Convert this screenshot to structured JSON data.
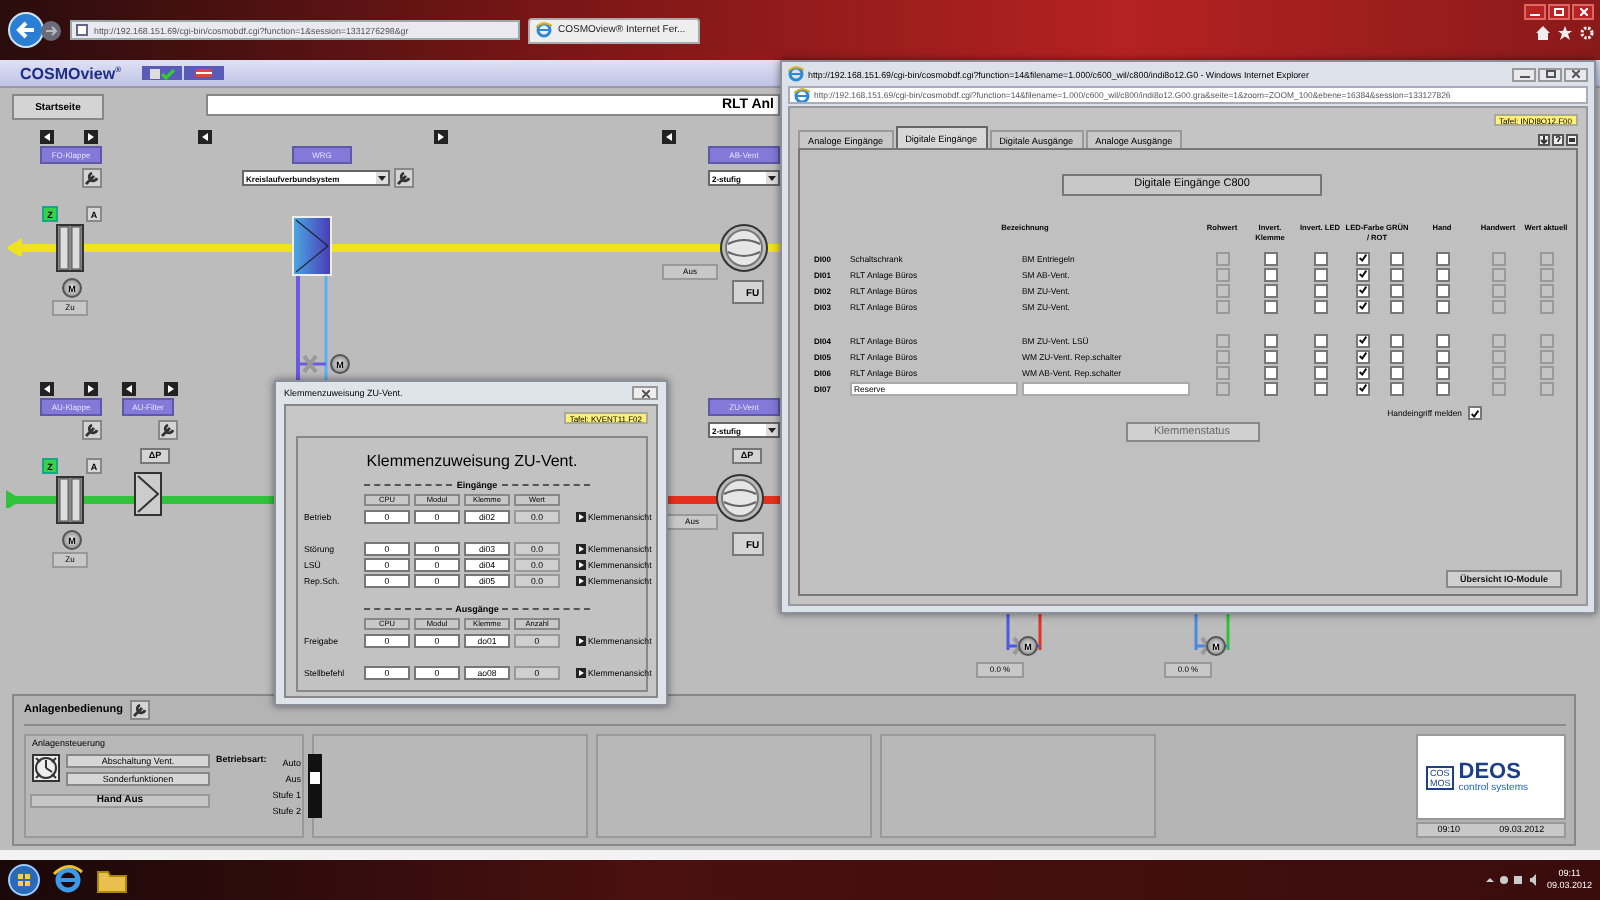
{
  "browser": {
    "address": "http://192.168.151.69/cgi-bin/cosmobdf.cgi?function=1&session=1331276298&gr",
    "tab": "COSMOview® Internet Fer..."
  },
  "app": {
    "logo": "COSMOview$^{®}$",
    "home_button": "Startseite",
    "page_title": "RLT Anl"
  },
  "schematic": {
    "exhaust": {
      "damper": {
        "label": "FO-Klappe",
        "buttons": [
          {
            "label": "Z",
            "selected": true
          },
          {
            "label": "A",
            "selected": false
          }
        ],
        "motor": "M",
        "value": "Zu"
      },
      "recovery": {
        "label": "WRG",
        "dropdown": "Kreislaufverbundsystem",
        "motor": "M"
      },
      "fan": {
        "label": "AB-Vent",
        "dropdown": "2-stufig",
        "value": "Aus",
        "drive": "FU"
      }
    },
    "supply": {
      "damper": {
        "label": "AU-Klappe",
        "buttons": [
          {
            "label": "Z",
            "selected": true
          },
          {
            "label": "A",
            "selected": false
          }
        ],
        "motor": "M",
        "value": "Zu"
      },
      "filter": {
        "label": "AU-Filter",
        "pressure": "ΔP"
      },
      "fan": {
        "label": "ZU-Vent",
        "dropdown": "2-stufig",
        "pressure": "ΔP",
        "value": "Aus",
        "drive": "FU"
      }
    },
    "valves": [
      {
        "motor": "M",
        "value": "0.0 %"
      },
      {
        "motor": "M",
        "value": "0.0 %"
      }
    ]
  },
  "bottom_panel": {
    "title": "Anlagenbedienung",
    "control": {
      "title": "Anlagensteuerung",
      "buttons": [
        "Abschaltung Vent.",
        "Sonderfunktionen"
      ],
      "status": "Hand Aus",
      "mode_label": "Betriebsart:",
      "modes": [
        {
          "label": "Auto",
          "selected": false
        },
        {
          "label": "Aus",
          "selected": true
        },
        {
          "label": "Stufe 1",
          "selected": false
        },
        {
          "label": "Stufe 2",
          "selected": false
        }
      ]
    },
    "logo": {
      "badge_top": "COS",
      "badge_bottom": "MOS",
      "name": "DEOS",
      "tagline": "control systems"
    },
    "time": "09:10",
    "date": "09.03.2012"
  },
  "terminal_window": {
    "title": "Klemmenzuweisung ZU-Vent.",
    "tag": "Tafel: KVENT11.F02",
    "heading": "Klemmenzuweisung ZU-Vent.",
    "sections": [
      {
        "title": "Eingänge",
        "columns": [
          "CPU",
          "Modul",
          "Klemme",
          "Wert"
        ],
        "row_groups": [
          [
            {
              "label": "Betrieb",
              "cells": [
                "0",
                "0",
                "di02",
                "0.0"
              ],
              "link": "Klemmenansicht"
            }
          ],
          [
            {
              "label": "Störung",
              "cells": [
                "0",
                "0",
                "di03",
                "0.0"
              ],
              "link": "Klemmenansicht"
            },
            {
              "label": "LSÜ",
              "cells": [
                "0",
                "0",
                "di04",
                "0.0"
              ],
              "link": "Klemmenansicht"
            },
            {
              "label": "Rep.Sch.",
              "cells": [
                "0",
                "0",
                "di05",
                "0.0"
              ],
              "link": "Klemmenansicht"
            }
          ]
        ]
      },
      {
        "title": "Ausgänge",
        "columns": [
          "CPU",
          "Modul",
          "Klemme",
          "Anzahl"
        ],
        "row_groups": [
          [
            {
              "label": "Freigabe",
              "cells": [
                "0",
                "0",
                "do01",
                "0"
              ],
              "link": "Klemmenansicht"
            }
          ],
          [
            {
              "label": "Stellbefehl",
              "cells": [
                "0",
                "0",
                "ao08",
                "0"
              ],
              "link": "Klemmenansicht"
            }
          ]
        ]
      }
    ]
  },
  "ie_window": {
    "title": "http://192.168.151.69/cgi-bin/cosmobdf.cgi?function=14&filename=1.000/c600_wil/c800/indi8o12.G0 - Windows Internet Explorer",
    "address": "http://192.168.151.69/cgi-bin/cosmobdf.cgi?function=14&filename=1.000/c600_wil/c800/indi8o12.G00.gra&seite=1&zoom=ZOOM_100&ebene=16384&session=133127826",
    "tag": "Tafel: INDI8O12.F00",
    "tabs": [
      {
        "label": "Analoge Eingänge",
        "selected": false
      },
      {
        "label": "Digitale Eingänge",
        "selected": true
      },
      {
        "label": "Digitale Ausgänge",
        "selected": false
      },
      {
        "label": "Analoge Ausgänge",
        "selected": false
      }
    ],
    "heading": "Digitale Eingänge C800",
    "columns": [
      "Bezeichnung",
      "Rohwert",
      "Invert. Klemme",
      "Invert. LED",
      "LED-Farbe GRÜN / ROT",
      "Hand",
      "Handwert",
      "Wert aktuell"
    ],
    "row_groups": [
      [
        {
          "channel": "DI00",
          "kind": "text",
          "name": "Schaltschrank",
          "description": "BM Entriegeln",
          "boxes": [
            {
              "checked": false,
              "disabled": true
            },
            {
              "checked": false,
              "disabled": false
            },
            {
              "checked": false,
              "disabled": false
            },
            {
              "checked": true,
              "disabled": false
            },
            {
              "checked": false,
              "disabled": false
            },
            {
              "checked": false,
              "disabled": false
            },
            {
              "checked": false,
              "disabled": true
            },
            {
              "checked": false,
              "disabled": true
            }
          ]
        },
        {
          "channel": "DI01",
          "kind": "text",
          "name": "RLT Anlage Büros",
          "description": "SM AB-Vent.",
          "boxes": [
            {
              "checked": false,
              "disabled": true
            },
            {
              "checked": false,
              "disabled": false
            },
            {
              "checked": false,
              "disabled": false
            },
            {
              "checked": true,
              "disabled": false
            },
            {
              "checked": false,
              "disabled": false
            },
            {
              "checked": false,
              "disabled": false
            },
            {
              "checked": false,
              "disabled": true
            },
            {
              "checked": false,
              "disabled": true
            }
          ]
        },
        {
          "channel": "DI02",
          "kind": "text",
          "name": "RLT Anlage Büros",
          "description": "BM ZU-Vent.",
          "boxes": [
            {
              "checked": false,
              "disabled": true
            },
            {
              "checked": false,
              "disabled": false
            },
            {
              "checked": false,
              "disabled": false
            },
            {
              "checked": true,
              "disabled": false
            },
            {
              "checked": false,
              "disabled": false
            },
            {
              "checked": false,
              "disabled": false
            },
            {
              "checked": false,
              "disabled": true
            },
            {
              "checked": false,
              "disabled": true
            }
          ]
        },
        {
          "channel": "DI03",
          "kind": "text",
          "name": "RLT Anlage Büros",
          "description": "SM ZU-Vent.",
          "boxes": [
            {
              "checked": false,
              "disabled": true
            },
            {
              "checked": false,
              "disabled": false
            },
            {
              "checked": false,
              "disabled": false
            },
            {
              "checked": true,
              "disabled": false
            },
            {
              "checked": false,
              "disabled": false
            },
            {
              "checked": false,
              "disabled": false
            },
            {
              "checked": false,
              "disabled": true
            },
            {
              "checked": false,
              "disabled": true
            }
          ]
        }
      ],
      [
        {
          "channel": "DI04",
          "kind": "text",
          "name": "RLT Anlage Büros",
          "description": "BM ZU-Vent. LSÜ",
          "boxes": [
            {
              "checked": false,
              "disabled": true
            },
            {
              "checked": false,
              "disabled": false
            },
            {
              "checked": false,
              "disabled": false
            },
            {
              "checked": true,
              "disabled": false
            },
            {
              "checked": false,
              "disabled": false
            },
            {
              "checked": false,
              "disabled": false
            },
            {
              "checked": false,
              "disabled": true
            },
            {
              "checked": false,
              "disabled": true
            }
          ]
        },
        {
          "channel": "DI05",
          "kind": "text",
          "name": "RLT Anlage Büros",
          "description": "WM ZU-Vent. Rep.schalter",
          "boxes": [
            {
              "checked": false,
              "disabled": true
            },
            {
              "checked": false,
              "disabled": false
            },
            {
              "checked": false,
              "disabled": false
            },
            {
              "checked": true,
              "disabled": false
            },
            {
              "checked": false,
              "disabled": false
            },
            {
              "checked": false,
              "disabled": false
            },
            {
              "checked": false,
              "disabled": true
            },
            {
              "checked": false,
              "disabled": true
            }
          ]
        },
        {
          "channel": "DI06",
          "kind": "text",
          "name": "RLT Anlage Büros",
          "description": "WM AB-Vent. Rep.schalter",
          "boxes": [
            {
              "checked": false,
              "disabled": true
            },
            {
              "checked": false,
              "disabled": false
            },
            {
              "checked": false,
              "disabled": false
            },
            {
              "checked": true,
              "disabled": false
            },
            {
              "checked": false,
              "disabled": false
            },
            {
              "checked": false,
              "disabled": false
            },
            {
              "checked": false,
              "disabled": true
            },
            {
              "checked": false,
              "disabled": true
            }
          ]
        },
        {
          "channel": "DI07",
          "kind": "input",
          "name": "Reserve",
          "boxes": [
            {
              "checked": false,
              "disabled": true
            },
            {
              "checked": false,
              "disabled": false
            },
            {
              "checked": false,
              "disabled": false
            },
            {
              "checked": true,
              "disabled": false
            },
            {
              "checked": false,
              "disabled": false
            },
            {
              "checked": false,
              "disabled": false
            },
            {
              "checked": false,
              "disabled": true
            },
            {
              "checked": false,
              "disabled": true
            }
          ]
        }
      ]
    ],
    "report": {
      "label": "Handeingriff melden",
      "checked": true
    },
    "buttons": [
      "Klemmenstatus",
      "Übersicht IO-Module"
    ]
  },
  "taskbar": {
    "time": "09:11",
    "date": "09.03.2012"
  }
}
